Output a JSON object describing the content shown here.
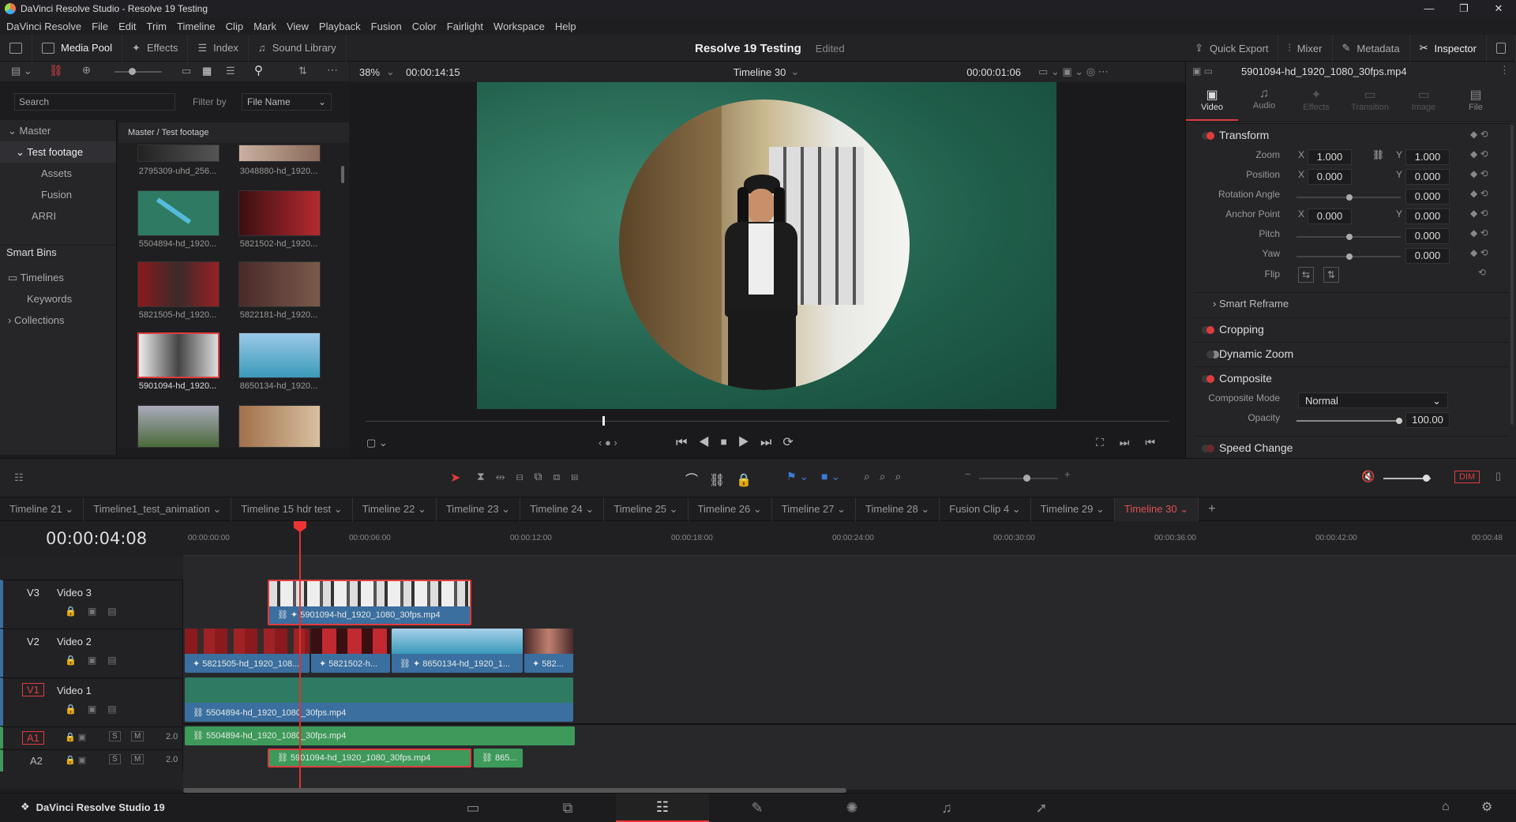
{
  "titlebar": {
    "title": "DaVinci Resolve Studio - Resolve 19 Testing",
    "min": "—",
    "max": "❐",
    "close": "✕"
  },
  "menu": [
    "DaVinci Resolve",
    "File",
    "Edit",
    "Trim",
    "Timeline",
    "Clip",
    "Mark",
    "View",
    "Playback",
    "Fusion",
    "Color",
    "Fairlight",
    "Workspace",
    "Help"
  ],
  "toolbar": {
    "media_pool": "Media Pool",
    "effects": "Effects",
    "index": "Index",
    "sound_library": "Sound Library",
    "project": "Resolve 19 Testing",
    "edited": "Edited",
    "quick_export": "Quick Export",
    "mixer": "Mixer",
    "metadata": "Metadata",
    "inspector": "Inspector"
  },
  "mediapool": {
    "search": "Search",
    "filter_by": "Filter by",
    "filter_value": "File Name",
    "path": "Master / Test footage",
    "tree": [
      "Master",
      "Test footage",
      "Assets",
      "Fusion",
      "ARRI"
    ],
    "smart_bins": "Smart Bins",
    "smart": [
      "Timelines",
      "Keywords",
      "Collections"
    ],
    "clips": [
      "2795309-uhd_256...",
      "3048880-hd_1920...",
      "5504894-hd_1920...",
      "5821502-hd_1920...",
      "5821505-hd_1920...",
      "5822181-hd_1920...",
      "5901094-hd_1920...",
      "8650134-hd_1920..."
    ]
  },
  "viewer": {
    "zoom": "38%",
    "source_tc": "00:00:14:15",
    "timeline": "Timeline 30",
    "record_tc": "00:00:01:06"
  },
  "inspector": {
    "clip": "5901094-hd_1920_1080_30fps.mp4",
    "tabs": [
      "Video",
      "Audio",
      "Effects",
      "Transition",
      "Image",
      "File"
    ],
    "transform": "Transform",
    "zoom": "Zoom",
    "zoom_x": "1.000",
    "zoom_y": "1.000",
    "position": "Position",
    "pos_x": "0.000",
    "pos_y": "0.000",
    "rotation": "Rotation Angle",
    "rot_v": "0.000",
    "anchor": "Anchor Point",
    "anc_x": "0.000",
    "anc_y": "0.000",
    "pitch": "Pitch",
    "pitch_v": "0.000",
    "yaw": "Yaw",
    "yaw_v": "0.000",
    "flip": "Flip",
    "smart_reframe": "Smart Reframe",
    "cropping": "Cropping",
    "dynamic_zoom": "Dynamic Zoom",
    "composite": "Composite",
    "composite_mode": "Composite Mode",
    "mode_value": "Normal",
    "opacity": "Opacity",
    "opacity_v": "100.00",
    "speed_change": "Speed Change",
    "x": "X",
    "y": "Y"
  },
  "edit": {
    "dim": "DIM"
  },
  "tabs": [
    "Timeline 21",
    "Timeline1_test_animation",
    "Timeline 15 hdr test",
    "Timeline 22",
    "Timeline 23",
    "Timeline 24",
    "Timeline 25",
    "Timeline 26",
    "Timeline 27",
    "Timeline 28",
    "Fusion Clip 4",
    "Timeline 29",
    "Timeline 30"
  ],
  "timeline": {
    "timecode": "00:00:04:08",
    "ruler": [
      "00:00:00:00",
      "00:00:06:00",
      "00:00:12:00",
      "00:00:18:00",
      "00:00:24:00",
      "00:00:30:00",
      "00:00:36:00",
      "00:00:42:00",
      "00:00:48"
    ],
    "tracks": [
      {
        "id": "V3",
        "name": "Video 3"
      },
      {
        "id": "V2",
        "name": "Video 2"
      },
      {
        "id": "V1",
        "name": "Video 1"
      },
      {
        "id": "A1",
        "name": "",
        "vol": "2.0"
      },
      {
        "id": "A2",
        "name": "",
        "vol": "2.0"
      }
    ],
    "clips": {
      "v3": "5901094-hd_1920_1080_30fps.mp4",
      "v2a": "5821505-hd_1920_108...",
      "v2b": "5821502-h...",
      "v2c": "8650134-hd_1920_1...",
      "v2d": "582...",
      "v1": "5504894-hd_1920_1080_30fps.mp4",
      "a1": "5504894-hd_1920_1080_30fps.mp4",
      "a2a": "5901094-hd_1920_1080_30fps.mp4",
      "a2b": "865..."
    },
    "s": "S",
    "m": "M"
  },
  "footer": {
    "app": "DaVinci Resolve Studio 19"
  }
}
